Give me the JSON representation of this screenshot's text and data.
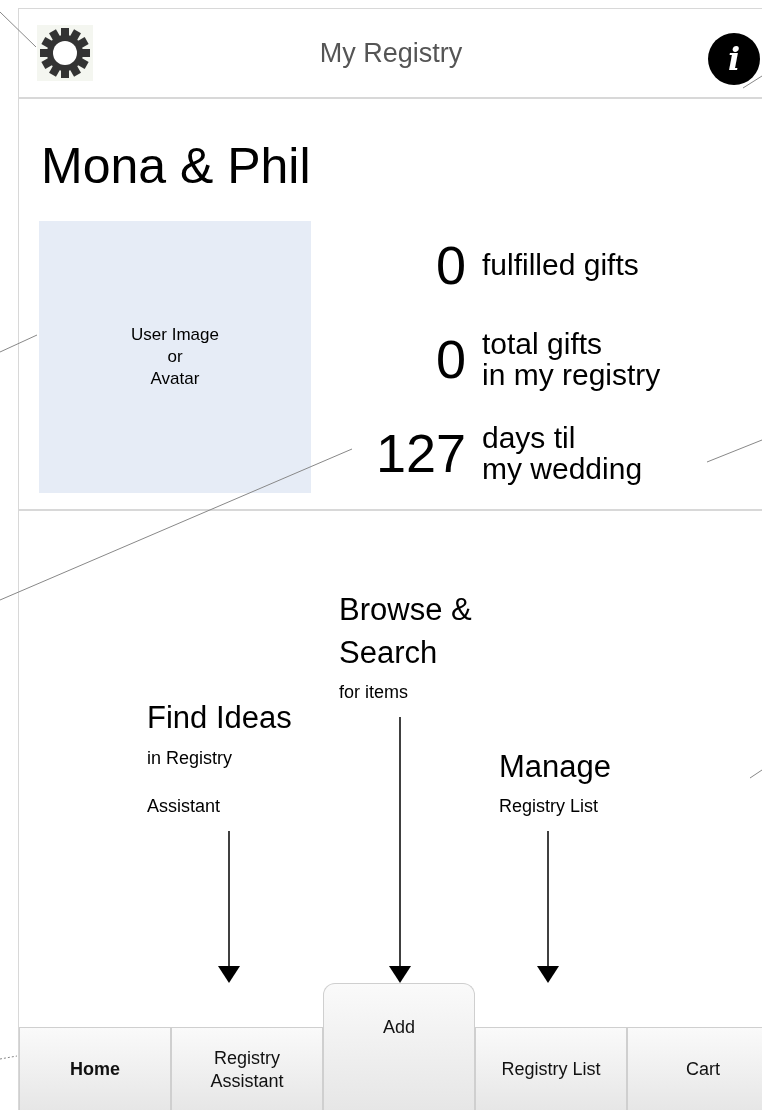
{
  "header": {
    "title": "My Registry",
    "info_glyph": "i"
  },
  "couple_names": "Mona & Phil",
  "avatar": {
    "label": "User Image\nor\nAvatar"
  },
  "stats": [
    {
      "value": "0",
      "label": "fulfilled gifts"
    },
    {
      "value": "0",
      "label": "total gifts\nin my registry"
    },
    {
      "value": "127",
      "label": "days til\nmy wedding"
    }
  ],
  "callouts": [
    {
      "title": "Find Ideas",
      "subtitle": "in Registry\nAssistant"
    },
    {
      "title": "Browse &\nSearch",
      "subtitle": "for items"
    },
    {
      "title": "Manage",
      "subtitle": "Registry List"
    }
  ],
  "tabs": [
    {
      "label": "Home",
      "selected": true,
      "kind": "flat"
    },
    {
      "label": "Registry\nAssistant",
      "selected": false,
      "kind": "flat"
    },
    {
      "label": "Add",
      "selected": false,
      "kind": "raised"
    },
    {
      "label": "Registry List",
      "selected": false,
      "kind": "flat"
    },
    {
      "label": "Cart",
      "selected": false,
      "kind": "flat"
    }
  ]
}
